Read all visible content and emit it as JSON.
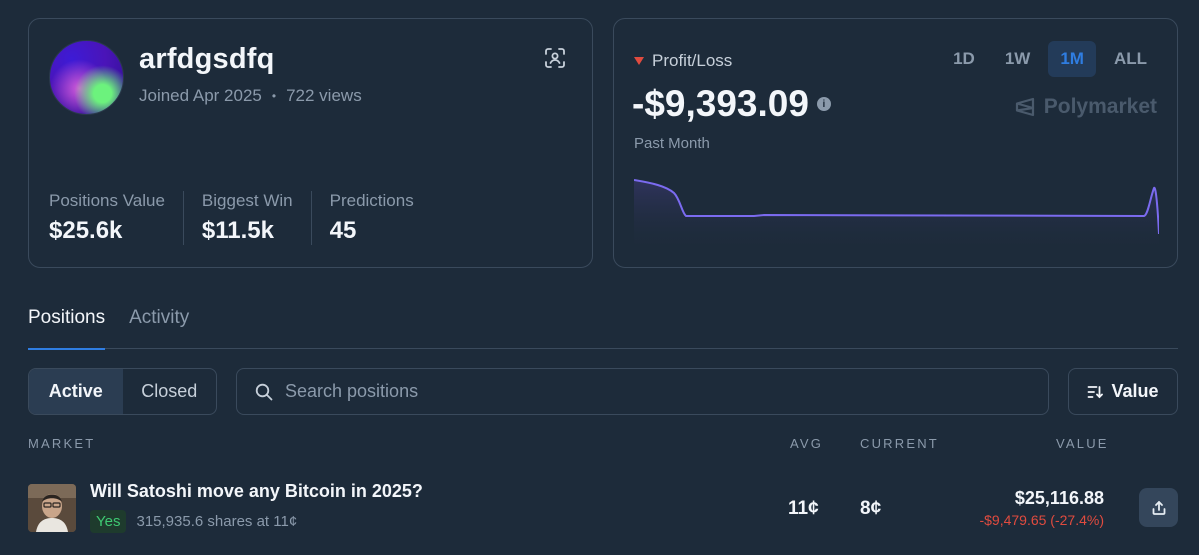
{
  "profile": {
    "username": "arfdgsdfq",
    "joined": "Joined Apr 2025",
    "views": "722 views",
    "stats": [
      {
        "label": "Positions Value",
        "value": "$25.6k"
      },
      {
        "label": "Biggest Win",
        "value": "$11.5k"
      },
      {
        "label": "Predictions",
        "value": "45"
      }
    ]
  },
  "pnl": {
    "label": "Profit/Loss",
    "value": "-$9,393.09",
    "period_label": "Past Month",
    "ranges": [
      "1D",
      "1W",
      "1M",
      "ALL"
    ],
    "active_range": "1M",
    "brand": "Polymarket",
    "colors": {
      "line": "#7b6bf0",
      "down": "#e04b3f"
    }
  },
  "tabs": [
    {
      "label": "Positions",
      "active": true
    },
    {
      "label": "Activity",
      "active": false
    }
  ],
  "filters": {
    "active_label": "Active",
    "closed_label": "Closed",
    "search_placeholder": "Search positions",
    "sort_label": "Value"
  },
  "table": {
    "headers": {
      "market": "MARKET",
      "avg": "AVG",
      "current": "CURRENT",
      "value": "VALUE"
    },
    "rows": [
      {
        "title": "Will Satoshi move any Bitcoin in 2025?",
        "outcome": "Yes",
        "shares": "315,935.6 shares at 11¢",
        "avg": "11¢",
        "current": "8¢",
        "value": "$25,116.88",
        "change": "-$9,479.65 (-27.4%)"
      }
    ]
  }
}
